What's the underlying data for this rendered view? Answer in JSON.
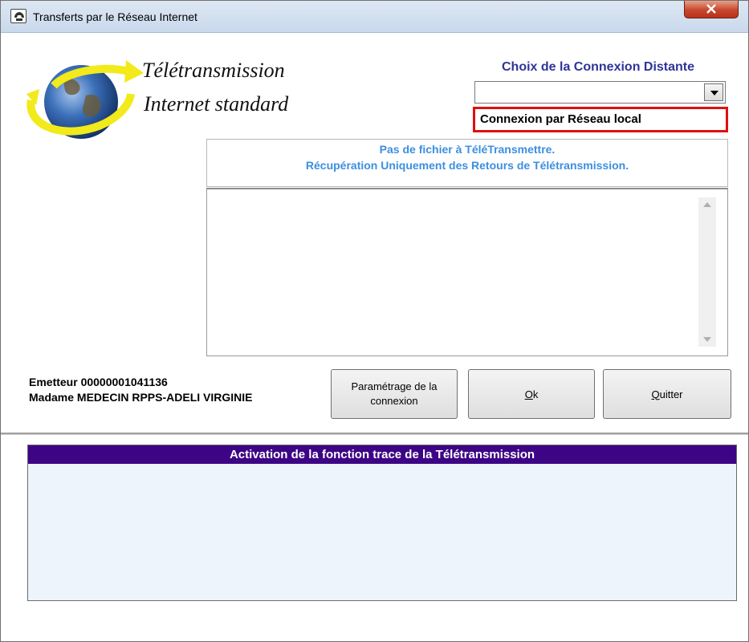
{
  "window": {
    "title": "Transferts par le Réseau Internet",
    "close_icon": "close-icon"
  },
  "logo": {
    "icon": "globe-arrow-icon",
    "line1": "Télétransmission",
    "line2": "Internet standard"
  },
  "connection": {
    "label": "Choix de la Connexion Distante",
    "selected_value": "",
    "option": "Connexion par Réseau local",
    "highlight_color": "#e01010"
  },
  "message": {
    "line1": "Pas de fichier à TéléTransmettre.",
    "line2": "Récupération Uniquement des Retours de Télétransmission.",
    "color": "#3c8fe0"
  },
  "sender": {
    "line1": "Emetteur 00000001041136",
    "line2": "Madame MEDECIN RPPS-ADELI VIRGINIE"
  },
  "buttons": {
    "param_line1": "Paramétrage de la",
    "param_line2": "connexion",
    "ok_mnemonic": "O",
    "ok_rest": "k",
    "quit_mnemonic": "Q",
    "quit_rest": "uitter"
  },
  "trace": {
    "title": "Activation de la fonction trace de la Télétransmission",
    "header_color": "#3d0585"
  }
}
